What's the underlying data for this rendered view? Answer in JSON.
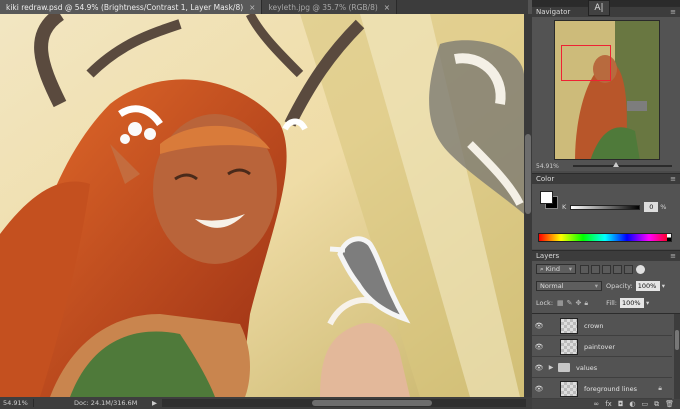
{
  "tabs": [
    {
      "label": "kiki redraw.psd @ 54.9% (Brightness/Contrast 1, Layer Mask/8)",
      "close": "×",
      "active": true
    },
    {
      "label": "keyleth.jpg @ 35.7% (RGB/8)",
      "close": "×",
      "active": false
    }
  ],
  "toolbar": {
    "ai_button": "A|"
  },
  "status": {
    "zoom": "54.91%",
    "doc": "Doc: 24.1M/316.6M",
    "arrow": "▶"
  },
  "navigator": {
    "title": "Navigator",
    "zoom": "54.91%",
    "menu": "≡"
  },
  "color": {
    "title": "Color",
    "k_label": "K",
    "k_value": "0",
    "k_unit": "%",
    "menu": "≡",
    "fg_color": "#ffffff",
    "bg_color": "#000000"
  },
  "layers": {
    "title": "Layers",
    "menu": "≡",
    "filter_kind": "Kind",
    "blend_mode": "Normal",
    "opacity_label": "Opacity:",
    "opacity_value": "100%",
    "lock_label": "Lock:",
    "fill_label": "Fill:",
    "fill_value": "100%",
    "items": [
      {
        "name": "crown",
        "type": "layer",
        "visible": true,
        "locked": false
      },
      {
        "name": "paintover",
        "type": "layer",
        "visible": true,
        "locked": false
      },
      {
        "name": "values",
        "type": "group",
        "visible": true,
        "locked": false
      },
      {
        "name": "foreground lines",
        "type": "layer",
        "visible": true,
        "locked": true
      }
    ],
    "footer_icons": [
      "link-icon",
      "fx-icon",
      "mask-icon",
      "adjustment-icon",
      "folder-icon",
      "new-layer-icon",
      "trash-icon"
    ]
  },
  "colors": {
    "accent_red": "#e22222",
    "panel_bg": "#535353",
    "tab_bg": "#3c3c3c"
  }
}
